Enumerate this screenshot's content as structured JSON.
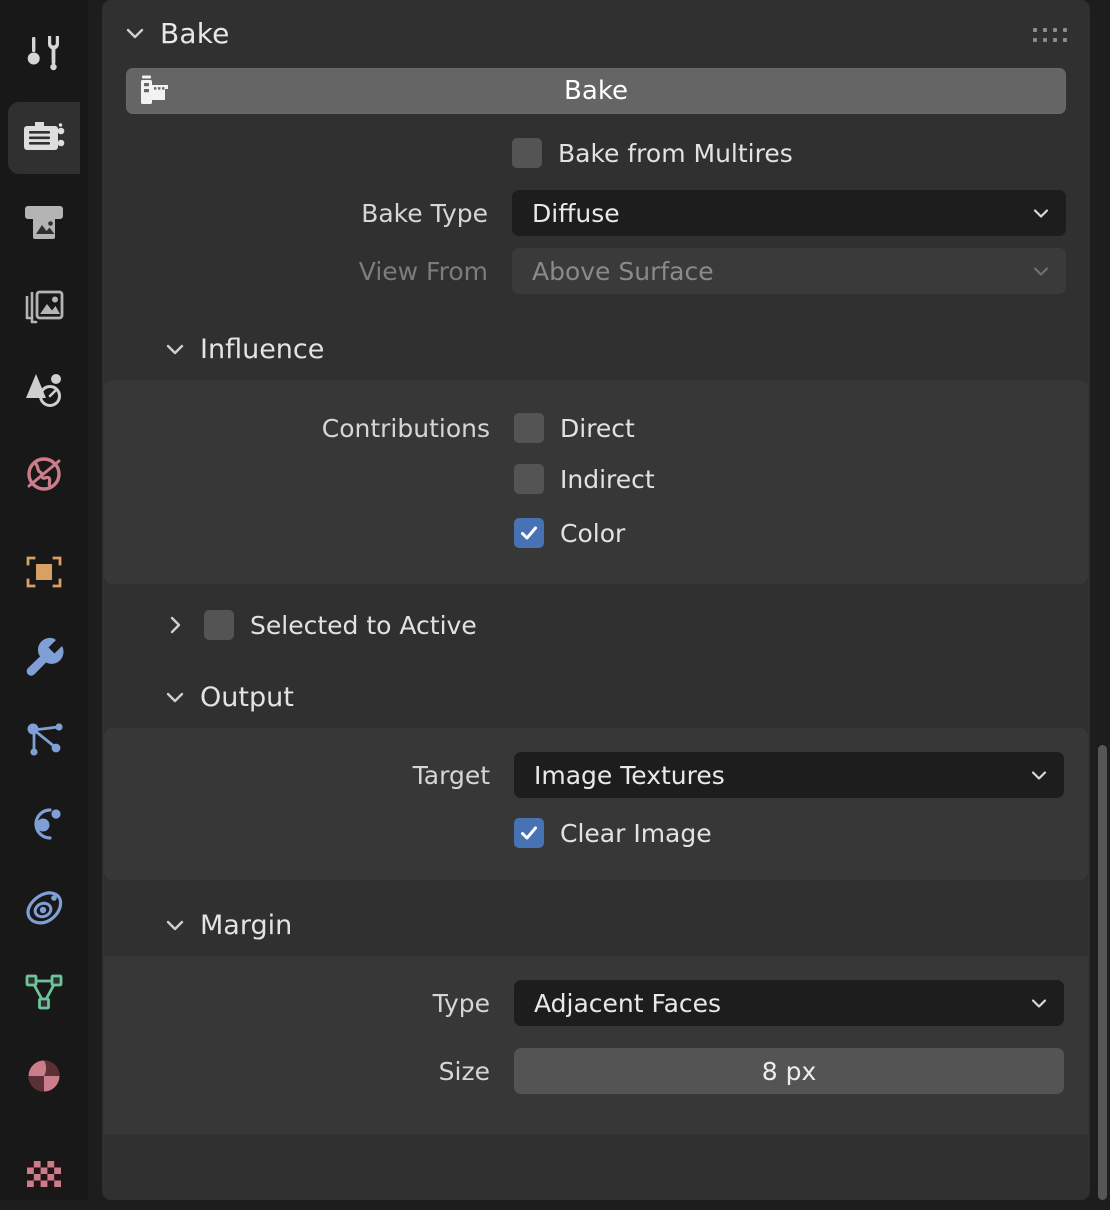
{
  "tabstrip": {
    "tabs": [
      {
        "name": "tool-properties",
        "icon": "tool-icon",
        "active": false,
        "color": "#d8d8d8"
      },
      {
        "name": "render-properties",
        "icon": "camera-back-icon",
        "active": true,
        "color": "#d8d8d8"
      },
      {
        "name": "output-properties",
        "icon": "printer-icon",
        "active": false,
        "color": "#b0b0b0"
      },
      {
        "name": "view-layer-properties",
        "icon": "image-stack-icon",
        "active": false,
        "color": "#b0b0b0"
      },
      {
        "name": "scene-properties",
        "icon": "cone-sphere-icon",
        "active": false,
        "color": "#c6c6c6"
      },
      {
        "name": "world-properties",
        "icon": "globe-icon",
        "active": false,
        "color": "#cc7d8a"
      },
      {
        "name": "object-properties",
        "icon": "orange-square-icon",
        "active": false,
        "color": "#d9a066"
      },
      {
        "name": "modifier-properties",
        "icon": "wrench-icon",
        "active": false,
        "color": "#7f9fd6"
      },
      {
        "name": "particle-properties",
        "icon": "particles-icon",
        "active": false,
        "color": "#7f9fd6"
      },
      {
        "name": "physics-properties",
        "icon": "orbit-icon",
        "active": false,
        "color": "#7f9fd6"
      },
      {
        "name": "object-constraint-properties",
        "icon": "constraint-icon",
        "active": false,
        "color": "#7f9fd6"
      },
      {
        "name": "object-data-properties",
        "icon": "mesh-data-icon",
        "active": false,
        "color": "#6cc49a"
      },
      {
        "name": "material-properties",
        "icon": "material-sphere-icon",
        "active": false,
        "color": "#cc7d8a"
      },
      {
        "name": "texture-properties",
        "icon": "checker-icon",
        "active": false,
        "color": "#cc7d8a"
      }
    ]
  },
  "panel": {
    "title": "Bake",
    "chevron_state": "expanded",
    "grip": "drag-grip-icon",
    "bake_button": {
      "label": "Bake",
      "icon": "render-film-icon"
    },
    "bake_from_multires": {
      "label": "Bake from Multires",
      "checked": false
    },
    "bake_type": {
      "label": "Bake Type",
      "value": "Diffuse",
      "enabled": true
    },
    "view_from": {
      "label": "View From",
      "value": "Above Surface",
      "enabled": false
    },
    "influence": {
      "title": "Influence",
      "chevron_state": "expanded",
      "contributions_label": "Contributions",
      "items": [
        {
          "label": "Direct",
          "checked": false
        },
        {
          "label": "Indirect",
          "checked": false
        },
        {
          "label": "Color",
          "checked": true
        }
      ]
    },
    "selected_to_active": {
      "title": "Selected to Active",
      "chevron_state": "collapsed",
      "checked": false
    },
    "output": {
      "title": "Output",
      "chevron_state": "expanded",
      "target": {
        "label": "Target",
        "value": "Image Textures"
      },
      "clear_image": {
        "label": "Clear Image",
        "checked": true
      }
    },
    "margin": {
      "title": "Margin",
      "chevron_state": "expanded",
      "type": {
        "label": "Type",
        "value": "Adjacent Faces"
      },
      "size": {
        "label": "Size",
        "value": "8 px"
      }
    }
  },
  "colors": {
    "panel_bg": "#303030",
    "subpanel_bg": "#373737",
    "window_bg": "#1d1d1d",
    "tabstrip_bg": "#181818",
    "field_bg": "#1d1d1d",
    "checkbox_off": "#545454",
    "checkbox_on": "#4772b3",
    "button_bg": "#656565",
    "text": "#e5e5e5",
    "text_dim": "#8a8a8a",
    "scrollbar": "#565656"
  }
}
